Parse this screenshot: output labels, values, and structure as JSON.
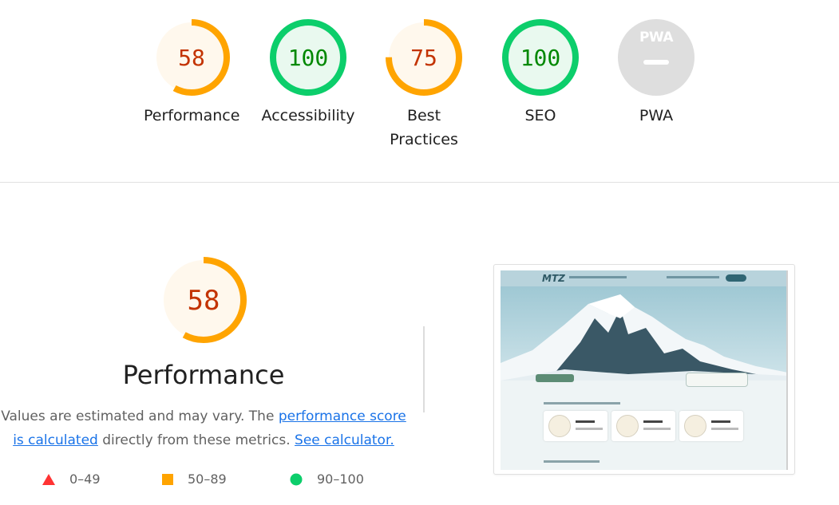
{
  "categories": [
    {
      "label": "Performance",
      "score": "58",
      "value": 58,
      "rating": "average"
    },
    {
      "label": "Accessibility",
      "score": "100",
      "value": 100,
      "rating": "pass"
    },
    {
      "label": "Best Practices",
      "score": "75",
      "value": 75,
      "rating": "average"
    },
    {
      "label": "SEO",
      "score": "100",
      "value": 100,
      "rating": "pass"
    },
    {
      "label": "PWA",
      "badge_text": "PWA",
      "rating": "na"
    }
  ],
  "performance": {
    "score": "58",
    "value": 58,
    "title": "Performance",
    "desc_prefix": "Values are estimated and may vary. The ",
    "link_score": "performance score is calculated",
    "desc_mid": " directly from these metrics. ",
    "link_calculator": "See calculator."
  },
  "legend": [
    {
      "shape": "triangle",
      "range": "0–49"
    },
    {
      "shape": "square",
      "range": "50–89"
    },
    {
      "shape": "circle",
      "range": "90–100"
    }
  ],
  "screenshot": {
    "logo_text": "MTZ"
  },
  "colors": {
    "average": "#ffa400",
    "average_text": "#c33300",
    "average_bg": "#fff8ed",
    "pass": "#0cce6b",
    "pass_text": "#008800",
    "pass_bg": "#e9f9ef",
    "fail": "#ff3333",
    "na": "#dedede"
  }
}
